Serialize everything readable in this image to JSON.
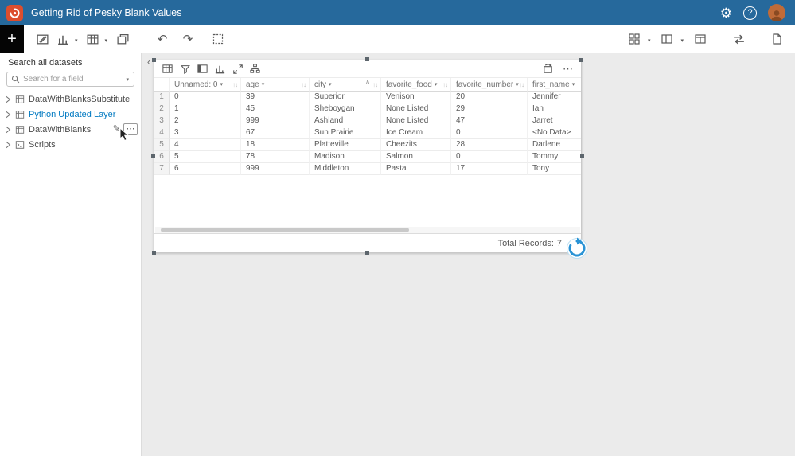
{
  "header": {
    "title": "Getting Rid of Pesky Blank Values",
    "gear_icon": "⚙",
    "help_icon": "?"
  },
  "toolbar": {
    "add_icon": "+",
    "undo_icon": "↶",
    "redo_icon": "↷",
    "chart_caret": "▾",
    "table_caret": "▾",
    "gallery_caret": "▾",
    "layout_caret": "▾"
  },
  "main": {
    "collapse_panel_icon": "‹"
  },
  "sidebar": {
    "search_label": "Search all datasets",
    "search_placeholder": "Search for a field",
    "search_caret": "▾",
    "items": [
      {
        "label": "DataWithBlanksSubstitute"
      },
      {
        "label": "Python Updated Layer"
      },
      {
        "label": "DataWithBlanks"
      },
      {
        "label": "Scripts"
      }
    ],
    "item_actions": {
      "edit_icon": "✎",
      "more_icon": "⋯"
    }
  },
  "card": {
    "more_icon": "⋯",
    "collapse_icon": "∧",
    "column_caret": "▾",
    "sort_icon": "↑↓",
    "columns": [
      {
        "name": "Unnamed: 0"
      },
      {
        "name": "age"
      },
      {
        "name": "city"
      },
      {
        "name": "favorite_food"
      },
      {
        "name": "favorite_number"
      },
      {
        "name": "first_name"
      }
    ],
    "rows": [
      {
        "n": "1",
        "cells": [
          "0",
          "39",
          "Superior",
          "Venison",
          "20",
          "Jennifer"
        ]
      },
      {
        "n": "2",
        "cells": [
          "1",
          "45",
          "Sheboygan",
          "None Listed",
          "29",
          "Ian"
        ]
      },
      {
        "n": "3",
        "cells": [
          "2",
          "999",
          "Ashland",
          "None Listed",
          "47",
          "Jarret"
        ]
      },
      {
        "n": "4",
        "cells": [
          "3",
          "67",
          "Sun Prairie",
          "Ice Cream",
          "0",
          "<No Data>"
        ]
      },
      {
        "n": "5",
        "cells": [
          "4",
          "18",
          "Platteville",
          "Cheezits",
          "28",
          "Darlene"
        ]
      },
      {
        "n": "6",
        "cells": [
          "5",
          "78",
          "Madison",
          "Salmon",
          "0",
          "Tommy"
        ]
      },
      {
        "n": "7",
        "cells": [
          "6",
          "999",
          "Middleton",
          "Pasta",
          "17",
          "Tony"
        ]
      }
    ],
    "footer": {
      "total_records_label": "Total Records:",
      "total_records_value": "7"
    }
  },
  "colors": {
    "header_bg": "#26699c",
    "accent_blue": "#0079c1",
    "logo_orange": "#dc4e2e",
    "icon_gray": "#595959"
  }
}
